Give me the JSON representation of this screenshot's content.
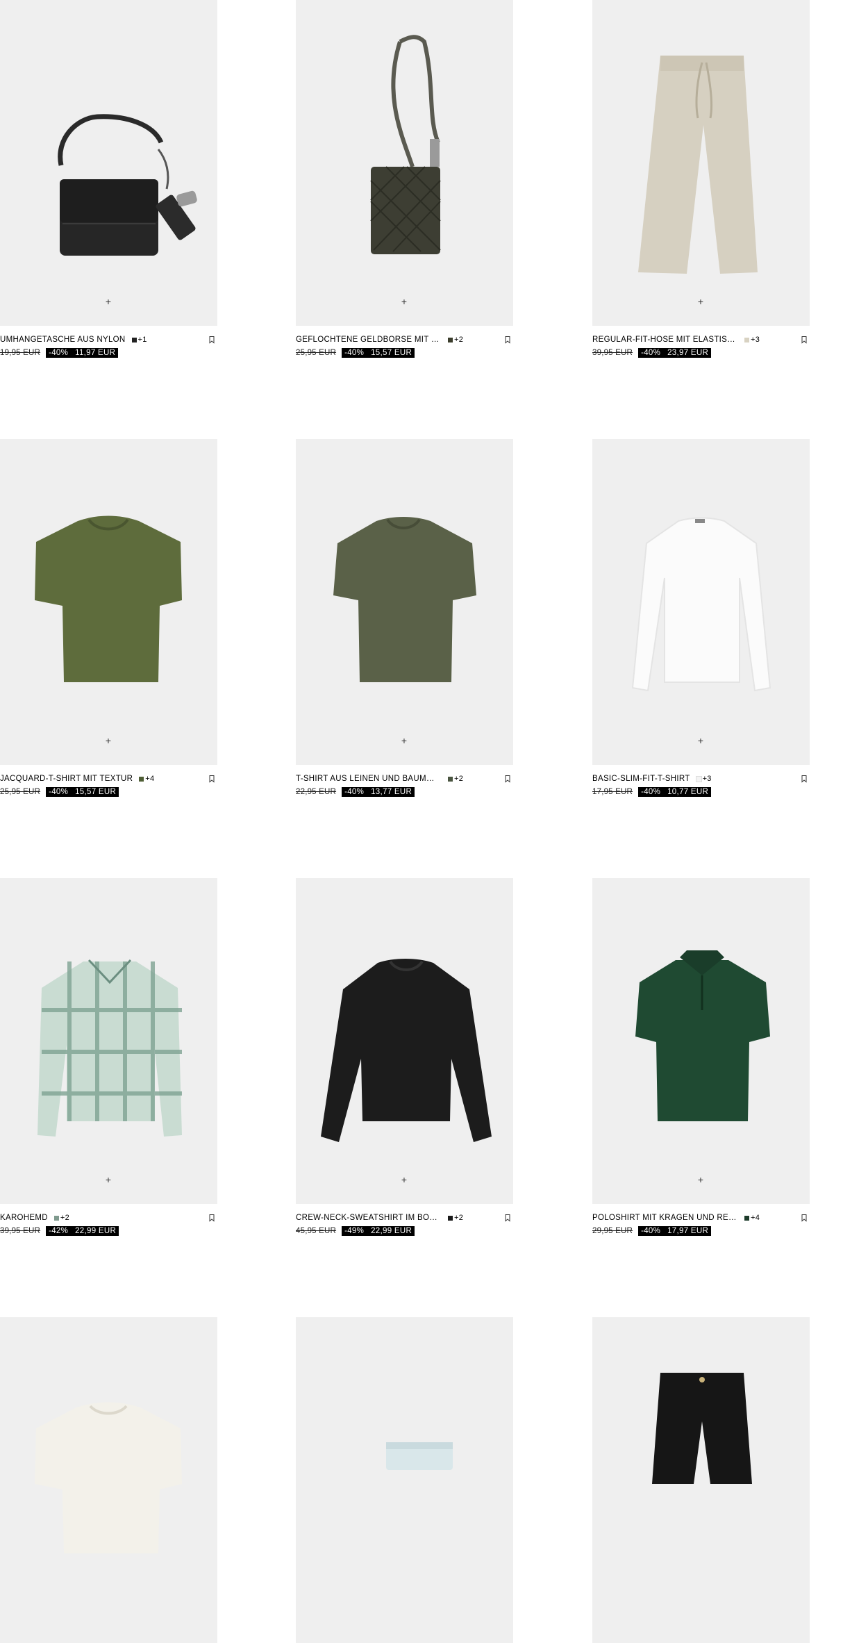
{
  "products": [
    {
      "name": "UMHÄNGETASCHE AUS NYLON",
      "swatch_color": "#222222",
      "more_colors": "+1",
      "old_price": "19,95 EUR",
      "discount": "-40%",
      "new_price": "11,97 EUR",
      "kind": "bag"
    },
    {
      "name": "GEFLOCHTENE GELDBÖRSE MIT REISS...",
      "swatch_color": "#3b3d2c",
      "more_colors": "+2",
      "old_price": "25,95 EUR",
      "discount": "-40%",
      "new_price": "15,57 EUR",
      "kind": "wallet"
    },
    {
      "name": "REGULAR-FIT-HOSE MIT ELASTISCHEM...",
      "swatch_color": "#d8d2c2",
      "more_colors": "+3",
      "old_price": "39,95 EUR",
      "discount": "-40%",
      "new_price": "23,97 EUR",
      "kind": "pants"
    },
    {
      "name": "JACQUARD-T-SHIRT MIT TEXTUR",
      "swatch_color": "#4f5e35",
      "more_colors": "+4",
      "old_price": "25,95 EUR",
      "discount": "-40%",
      "new_price": "15,57 EUR",
      "kind": "tee-green"
    },
    {
      "name": "T-SHIRT AUS LEINEN UND BAUMWOLLE",
      "swatch_color": "#4a5540",
      "more_colors": "+2",
      "old_price": "22,95 EUR",
      "discount": "-40%",
      "new_price": "13,77 EUR",
      "kind": "tee-olive"
    },
    {
      "name": "BASIC-SLIM-FIT-T-SHIRT",
      "swatch_color": "#f4f4f4",
      "more_colors": "+3",
      "old_price": "17,95 EUR",
      "discount": "-40%",
      "new_price": "10,77 EUR",
      "kind": "longsleeve-white"
    },
    {
      "name": "KAROHEMD",
      "swatch_color": "#7f9a8e",
      "more_colors": "+2",
      "old_price": "39,95 EUR",
      "discount": "-42%",
      "new_price": "22,99 EUR",
      "kind": "shirt-check"
    },
    {
      "name": "CREW-NECK-SWEATSHIRT IM BOXY FIT",
      "swatch_color": "#1a1a1a",
      "more_colors": "+2",
      "old_price": "45,95 EUR",
      "discount": "-49%",
      "new_price": "22,99 EUR",
      "kind": "sweatshirt"
    },
    {
      "name": "POLOSHIRT MIT KRAGEN UND REISSV...",
      "swatch_color": "#1d3b2a",
      "more_colors": "+4",
      "old_price": "29,95 EUR",
      "discount": "-40%",
      "new_price": "17,97 EUR",
      "kind": "polo"
    },
    {
      "name": "",
      "kind": "tee-cream"
    },
    {
      "name": "",
      "kind": "shorts-light"
    },
    {
      "name": "",
      "kind": "shorts-black"
    }
  ],
  "icons": {
    "add": "plus-icon",
    "save": "bookmark-icon"
  },
  "add_symbol": "+"
}
